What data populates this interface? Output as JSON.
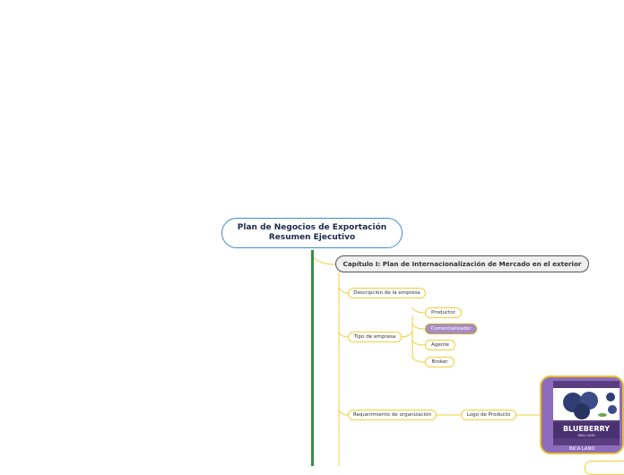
{
  "root": {
    "line1": "Plan de Negocios de Exportación",
    "line2": "Resumen Ejecutivo"
  },
  "chapter": {
    "label": "Capítulo I: Plan de Internacionalización de Mercado en el exterior"
  },
  "branches": {
    "descripcion": "Descripción de la empresa",
    "tipo": "Tipo de empresa",
    "requerimiento": "Requerimiento de organización"
  },
  "tipo_children": [
    "Productor",
    "Comercializador",
    "Agente",
    "Broker"
  ],
  "logo": {
    "label": "Logo de Producto",
    "brand": "BLUEBERRY",
    "sub": "INKA LAND",
    "caption": "INCA LAND"
  },
  "colors": {
    "accent_border": "#3f8bd6",
    "trunk": "#3d8b4a",
    "leaf_border": "#f0cf3a",
    "selected": "#a78bc6",
    "image_bg": "#8e6cbd"
  }
}
